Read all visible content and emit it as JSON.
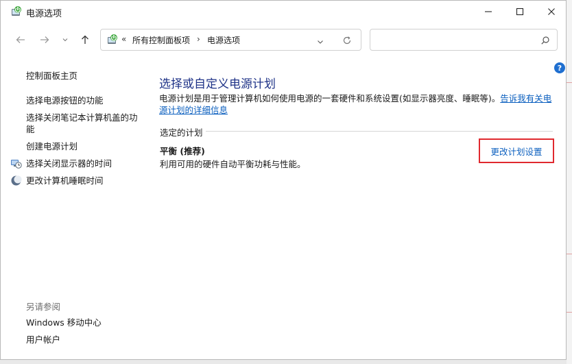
{
  "window": {
    "title": "电源选项"
  },
  "address_bar": {
    "prefix": "«",
    "crumbs": [
      "所有控制面板项",
      "电源选项"
    ],
    "separator": "›"
  },
  "search": {
    "placeholder": ""
  },
  "sidebar": {
    "items": [
      {
        "label": "控制面板主页"
      },
      {
        "label": "选择电源按钮的功能"
      },
      {
        "label": "选择关闭笔记本计算机盖的功能"
      },
      {
        "label": "创建电源计划"
      },
      {
        "label": "选择关闭显示器的时间",
        "icon": "monitor-clock-icon"
      },
      {
        "label": "更改计算机睡眠时间",
        "icon": "moon-icon"
      }
    ],
    "see_also_heading": "另请参阅",
    "see_also": [
      {
        "label": "Windows 移动中心"
      },
      {
        "label": "用户帐户"
      }
    ]
  },
  "main": {
    "title": "选择或自定义电源计划",
    "description": "电源计划是用于管理计算机如何使用电源的一套硬件和系统设置(如显示器亮度、睡眠等)。",
    "description_link": "告诉我有关电源计划的详细信息",
    "section_label": "选定的计划",
    "plan_name": "平衡 (推荐)",
    "plan_description": "利用可用的硬件自动平衡功耗与性能。",
    "change_plan_link": "更改计划设置"
  },
  "help": {
    "glyph": "?"
  },
  "colors": {
    "title_blue": "#1e3287",
    "link_blue": "#0b5fbf",
    "highlight_red": "#e0282e",
    "help_blue": "#1f6fd0"
  }
}
